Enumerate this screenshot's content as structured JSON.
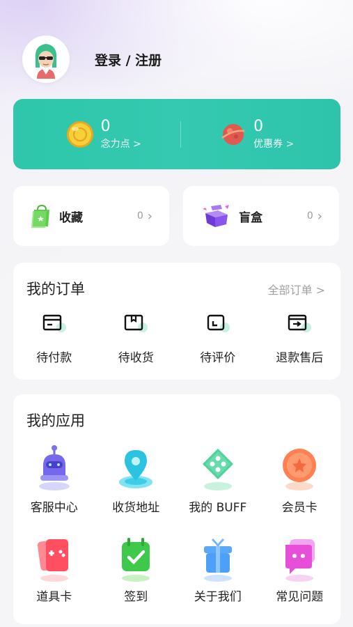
{
  "header": {
    "login_label": "登录 / 注册"
  },
  "points": {
    "nianli": {
      "value": "0",
      "label": "念力点 >"
    },
    "coupon": {
      "value": "0",
      "label": "优惠券 >"
    }
  },
  "quick": {
    "favorites": {
      "label": "收藏",
      "count": "0"
    },
    "blindbox": {
      "label": "盲盒",
      "count": "0"
    }
  },
  "orders": {
    "title": "我的订单",
    "all_link": "全部订单 >",
    "items": [
      {
        "label": "待付款",
        "icon": "wallet-icon"
      },
      {
        "label": "待收货",
        "icon": "package-icon"
      },
      {
        "label": "待评价",
        "icon": "review-icon"
      },
      {
        "label": "退款售后",
        "icon": "refund-icon"
      }
    ]
  },
  "apps": {
    "title": "我的应用",
    "items": [
      {
        "label": "客服中心",
        "icon": "robot-icon"
      },
      {
        "label": "收货地址",
        "icon": "location-pin-icon"
      },
      {
        "label": "我的 BUFF",
        "icon": "dice-icon"
      },
      {
        "label": "会员卡",
        "icon": "member-badge-icon"
      },
      {
        "label": "道具卡",
        "icon": "game-card-icon"
      },
      {
        "label": "签到",
        "icon": "calendar-check-icon"
      },
      {
        "label": "关于我们",
        "icon": "gift-box-icon"
      },
      {
        "label": "常见问题",
        "icon": "chat-bubble-icon"
      }
    ]
  },
  "colors": {
    "accent": "#2ec7ab",
    "background": "#f5f5f7"
  }
}
